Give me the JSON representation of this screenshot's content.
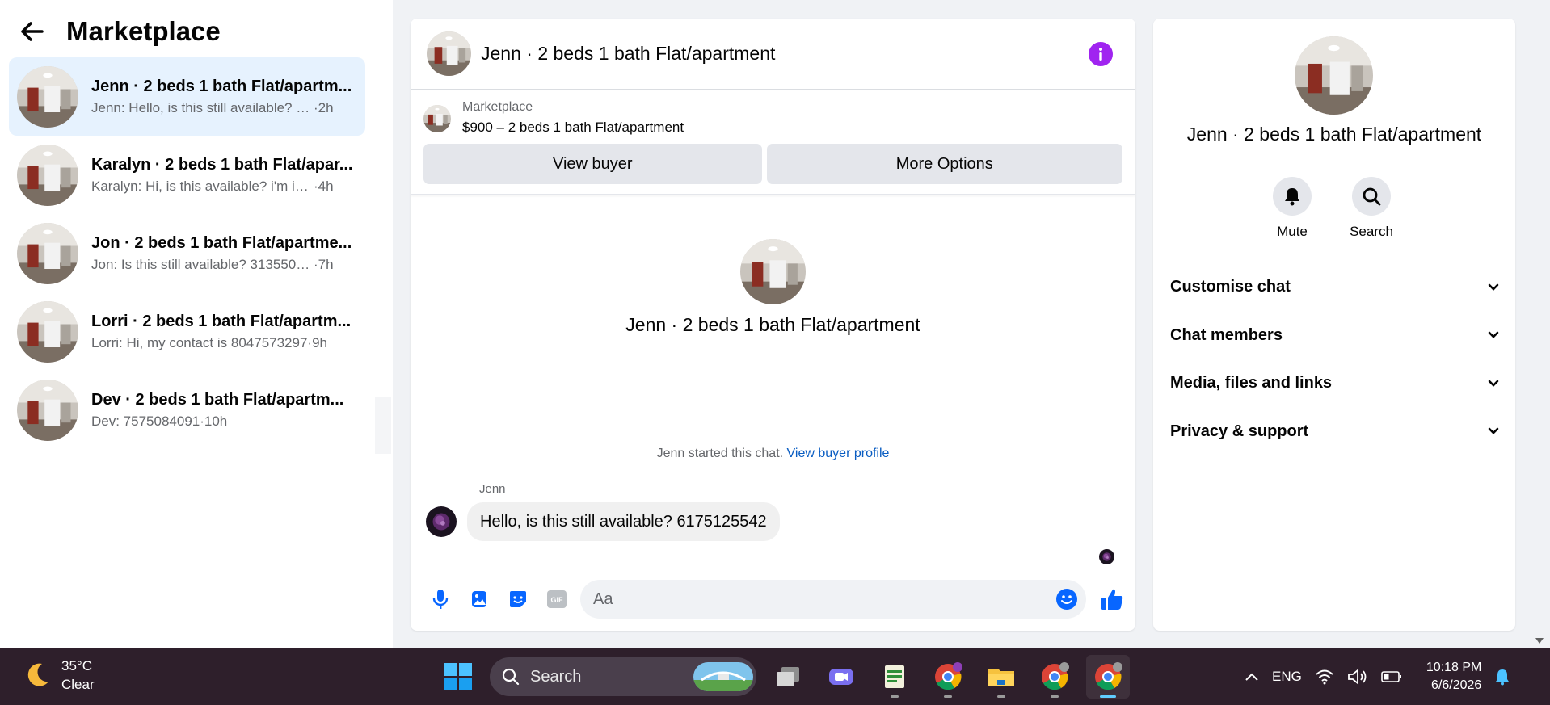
{
  "sidebar": {
    "title": "Marketplace",
    "conversations": [
      {
        "name": "Jenn · 2 beds 1 bath Flat/apartm...",
        "snippet": "Jenn: Hello, is this still available? 6...",
        "time": " ·2h"
      },
      {
        "name": "Karalyn · 2 beds 1 bath Flat/apar...",
        "snippet": "Karalyn: Hi, is this available? i'm int...",
        "time": " ·4h"
      },
      {
        "name": "Jon · 2 beds 1 bath Flat/apartme...",
        "snippet": "Jon: Is this still available? 3135504...",
        "time": " ·7h"
      },
      {
        "name": "Lorri · 2 beds 1 bath Flat/apartm...",
        "snippet": "Lorri: Hi, my contact is 8047573297",
        "time": " ·9h"
      },
      {
        "name": "Dev · 2 beds 1 bath Flat/apartm...",
        "snippet": "Dev: 7575084091",
        "time": " ·10h"
      }
    ]
  },
  "chat": {
    "title": "Jenn · 2 beds 1 bath Flat/apartment",
    "listing": {
      "source": "Marketplace",
      "price_title": "$900 – 2 beds 1 bath Flat/apartment",
      "view_buyer": "View buyer",
      "more_options": "More Options"
    },
    "intro_name": "Jenn · 2 beds 1 bath Flat/apartment",
    "started_text": "Jenn started this chat.",
    "view_profile": "View buyer profile",
    "sender": "Jenn",
    "message": "Hello, is this still available? 6175125542",
    "composer_placeholder": "Aa"
  },
  "details": {
    "name": "Jenn · 2 beds 1 bath Flat/apartment",
    "mute": "Mute",
    "search": "Search",
    "sections": [
      "Customise chat",
      "Chat members",
      "Media, files and links",
      "Privacy & support"
    ]
  },
  "taskbar": {
    "temperature": "35°C",
    "condition": "Clear",
    "search": "Search",
    "language": "ENG",
    "time": "10:18 PM",
    "date": "6/6/2026"
  },
  "colors": {
    "accent_blue": "#0866ff",
    "info_purple": "#a024f0",
    "active_row": "#e6f2fe",
    "taskbar": "#2e1f2b"
  }
}
